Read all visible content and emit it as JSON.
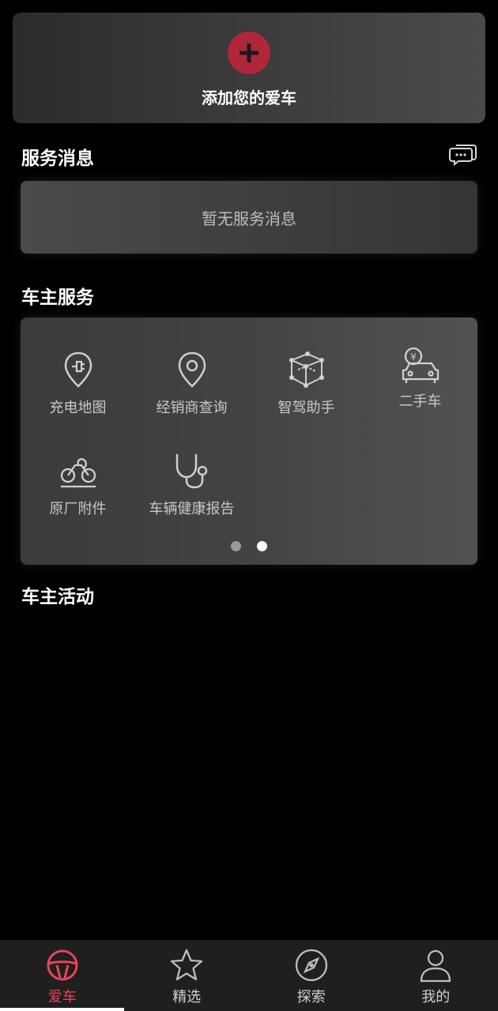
{
  "add_car": {
    "label": "添加您的爱车"
  },
  "service_messages": {
    "title": "服务消息",
    "empty_text": "暂无服务消息"
  },
  "owner_services": {
    "title": "车主服务",
    "items": [
      {
        "label": "充电地图",
        "icon": "charging-pin-icon"
      },
      {
        "label": "经销商查询",
        "icon": "location-pin-icon"
      },
      {
        "label": "智驾助手",
        "icon": "cube-3d-icon"
      },
      {
        "label": "二手车",
        "icon": "used-car-yuan-icon"
      },
      {
        "label": "原厂附件",
        "icon": "motorbike-icon"
      },
      {
        "label": "车辆健康报告",
        "icon": "stethoscope-icon"
      }
    ],
    "pager": {
      "pages": 2,
      "current": 2
    }
  },
  "owner_activities": {
    "title": "车主活动"
  },
  "tabbar": {
    "tabs": [
      {
        "label": "爱车",
        "icon": "steering-wheel-icon",
        "active": true
      },
      {
        "label": "精选",
        "icon": "star-icon",
        "active": false
      },
      {
        "label": "探索",
        "icon": "compass-icon",
        "active": false
      },
      {
        "label": "我的",
        "icon": "user-icon",
        "active": false
      }
    ]
  },
  "colors": {
    "accent": "#e8455a",
    "add_button": "#b0273a",
    "background": "#000000"
  }
}
